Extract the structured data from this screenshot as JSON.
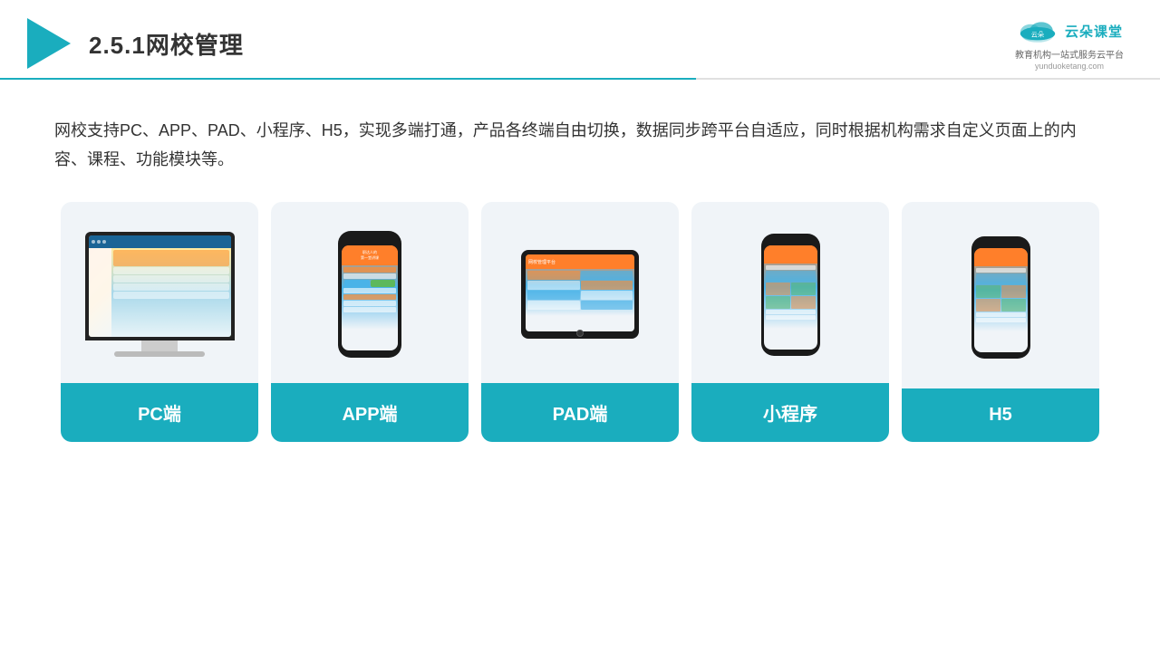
{
  "header": {
    "title": "2.5.1网校管理",
    "brand_name": "云朵课堂",
    "brand_url": "yunduoketang.com",
    "brand_sub": "教育机构一站\n式服务云平台"
  },
  "description": {
    "text": "网校支持PC、APP、PAD、小程序、H5，实现多端打通，产品各终端自由切换，数据同步跨平台自适应，同时根据机构需求自定义页面上的内容、课程、功能模块等。"
  },
  "cards": [
    {
      "id": "pc",
      "label": "PC端"
    },
    {
      "id": "app",
      "label": "APP端"
    },
    {
      "id": "pad",
      "label": "PAD端"
    },
    {
      "id": "miniprogram",
      "label": "小程序"
    },
    {
      "id": "h5",
      "label": "H5"
    }
  ]
}
